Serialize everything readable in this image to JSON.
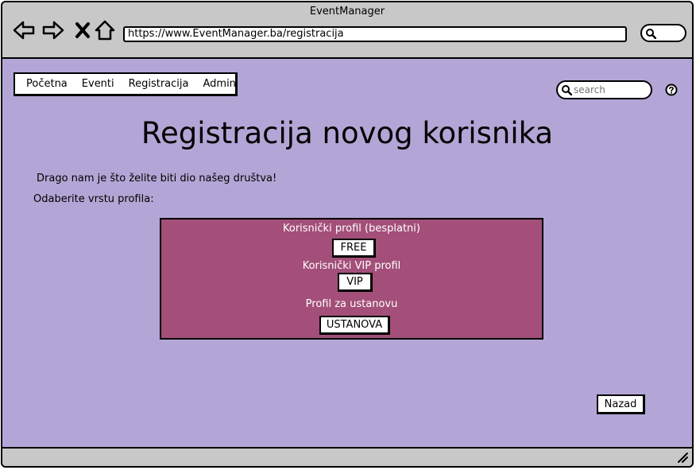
{
  "window": {
    "title": "EventManager"
  },
  "browser": {
    "url": "https://www.EventManager.ba/registracija",
    "icons": [
      "back-arrow-icon",
      "forward-arrow-icon",
      "close-x-icon",
      "home-icon",
      "search-icon"
    ]
  },
  "menu": {
    "items": [
      {
        "label": "Početna"
      },
      {
        "label": "Eventi"
      },
      {
        "label": "Registracija"
      },
      {
        "label": "Admin"
      }
    ]
  },
  "search": {
    "placeholder": "search"
  },
  "help": {
    "icon": "help-icon"
  },
  "page": {
    "heading": "Registracija novog korisnika",
    "welcome": "Drago nam je što želite biti dio našeg društva!",
    "prompt": "Odaberite vrstu profila:"
  },
  "profiles": [
    {
      "label": "Korisnički profil (besplatni)",
      "button": "FREE"
    },
    {
      "label": "Korisnički VIP profil",
      "button": "VIP"
    },
    {
      "label": "Profil za ustanovu",
      "button": "USTANOVA"
    }
  ],
  "footer": {
    "back_button": "Nazad"
  },
  "colors": {
    "background": "#b3a6d6",
    "panel": "#a34f79",
    "chrome": "#c8c8c8"
  }
}
